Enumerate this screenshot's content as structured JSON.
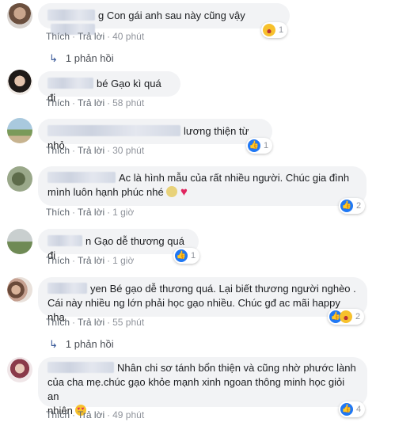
{
  "actions": {
    "like": "Thích",
    "reply": "Trả lời",
    "sep": "·"
  },
  "comments": [
    {
      "text": "g Con gái anh sau này cũng vậy",
      "time": "40 phút",
      "reaction_count": "1",
      "reactions": [
        "haha-icon"
      ],
      "replies": "1 phản hồi"
    },
    {
      "text": "bé Gạo kì quá đi",
      "time": "58 phút"
    },
    {
      "text": "lương thiện từ nhỏ",
      "time": "30 phút",
      "reaction_count": "1",
      "reactions": [
        "like-icon"
      ]
    },
    {
      "text_line1": "Ac là hình mẫu của rất nhiều người. Chúc gia đình",
      "text_line2": "mình luôn hạnh phúc nhé",
      "time": "1 giờ",
      "reaction_count": "2",
      "reactions": [
        "like-icon"
      ]
    },
    {
      "text": "n Gạo dễ thương quá đi",
      "time": "1 giờ",
      "reaction_count": "1",
      "reactions": [
        "like-icon"
      ]
    },
    {
      "text_line1": "yen Bé gạo dễ thương quá. Lại biết thương người nghèo .",
      "text_line2": "Cái này nhiều ng lớn phải học gạo nhiều. Chúc gđ ac mãi happy nha",
      "time": "55 phút",
      "reaction_count": "2",
      "reactions": [
        "like-icon",
        "haha-icon"
      ],
      "replies": "1 phản hồi"
    },
    {
      "text_line1": "Nhân chi sơ tánh bổn thiện và cũng nhờ phước lành",
      "text_line2": "của cha mẹ.chúc gạo khỏe mạnh xinh ngoan thông minh học giỏi an",
      "text_line3": "nhiên",
      "time": "49 phút",
      "reaction_count": "4",
      "reactions": [
        "like-icon"
      ]
    }
  ],
  "colors": {
    "bubble": "#f2f3f5",
    "link": "#385898",
    "like": "#2078f4",
    "muted": "#90949c"
  }
}
